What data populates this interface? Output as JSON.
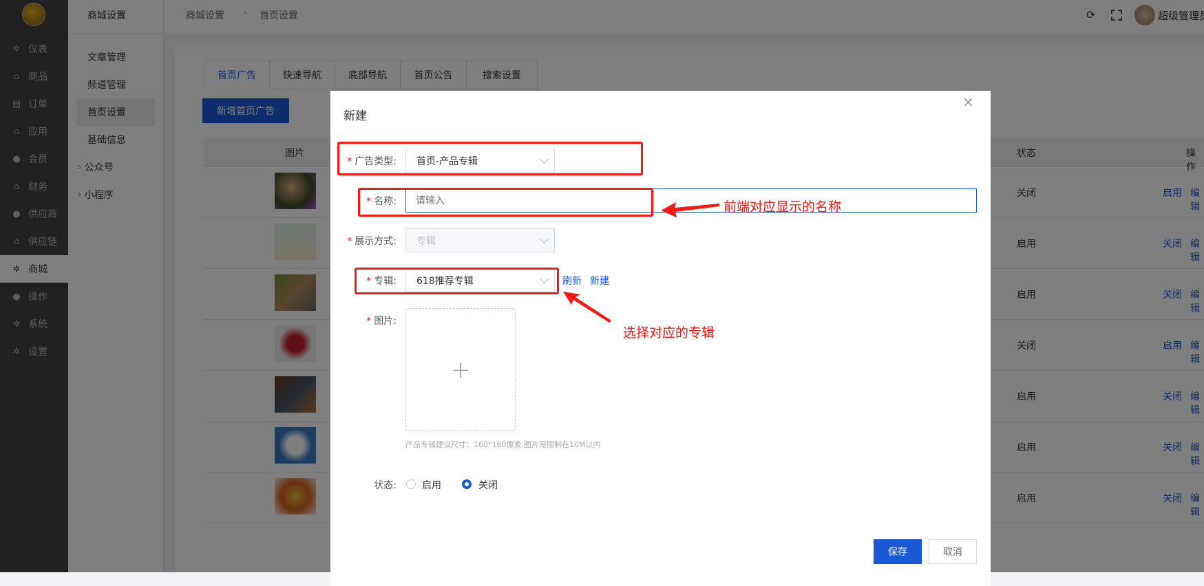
{
  "sidebar": {
    "items": [
      {
        "label": "仪表",
        "icon": "gear-outline-icon"
      },
      {
        "label": "商品",
        "icon": "bag-icon"
      },
      {
        "label": "订单",
        "icon": "clipboard-icon"
      },
      {
        "label": "应用",
        "icon": "bag-icon"
      },
      {
        "label": "会员",
        "icon": "user-icon"
      },
      {
        "label": "财务",
        "icon": "bag-icon"
      },
      {
        "label": "供应商",
        "icon": "user-icon"
      },
      {
        "label": "供应链",
        "icon": "bag-icon"
      },
      {
        "label": "商城",
        "icon": "gear-icon",
        "active": true
      },
      {
        "label": "操作",
        "icon": "user-icon"
      },
      {
        "label": "系统",
        "icon": "gear-icon"
      },
      {
        "label": "设置",
        "icon": "gear-icon"
      }
    ]
  },
  "subnav": {
    "title": "商城设置",
    "items": [
      {
        "label": "文章管理"
      },
      {
        "label": "频道管理"
      },
      {
        "label": "首页设置",
        "active": true
      },
      {
        "label": "基础信息"
      },
      {
        "label": "公众号",
        "expandable": true
      },
      {
        "label": "小程序",
        "expandable": true
      }
    ]
  },
  "header": {
    "breadcrumb": [
      "商城设置",
      "首页设置"
    ],
    "user": "超级管理员"
  },
  "tabs": [
    "首页广告",
    "快速导航",
    "底部导航",
    "首页公告",
    "搜索设置"
  ],
  "add_button": "新增首页广告",
  "table": {
    "headers": {
      "image": "图片",
      "status": "状态",
      "actions": "操作"
    },
    "rows": [
      {
        "status": "关闭",
        "toggle": "启用",
        "edit": "编辑"
      },
      {
        "status": "启用",
        "toggle": "关闭",
        "edit": "编辑"
      },
      {
        "status": "启用",
        "toggle": "关闭",
        "edit": "编辑"
      },
      {
        "status": "关闭",
        "toggle": "启用",
        "edit": "编辑"
      },
      {
        "status": "启用",
        "toggle": "关闭",
        "edit": "编辑"
      },
      {
        "status": "启用",
        "toggle": "关闭",
        "edit": "编辑"
      },
      {
        "status": "启用",
        "toggle": "关闭",
        "edit": "编辑"
      }
    ]
  },
  "modal": {
    "title": "新建",
    "ad_type": {
      "label": "广告类型:",
      "value": "首页-产品专辑"
    },
    "name": {
      "label": "名称:",
      "placeholder": "请输入",
      "value": ""
    },
    "display": {
      "label": "展示方式:",
      "value": "专辑"
    },
    "album": {
      "label": "专辑:",
      "value": "618推荐专辑",
      "refresh": "刷新",
      "new": "新建"
    },
    "image": {
      "label": "图片:",
      "hint": "产品专辑建议尺寸：160*160像素,图片需限制在10M以内"
    },
    "status": {
      "label": "状态:",
      "options": [
        "启用",
        "关闭"
      ],
      "selected": "关闭"
    },
    "save": "保存",
    "cancel": "取消"
  },
  "annotations": {
    "name_note": "前端对应显示的名称",
    "album_note": "选择对应的专辑"
  },
  "colors": {
    "primary": "#1a58d6",
    "annotation": "#f31b14",
    "sidebar": "#424242"
  }
}
